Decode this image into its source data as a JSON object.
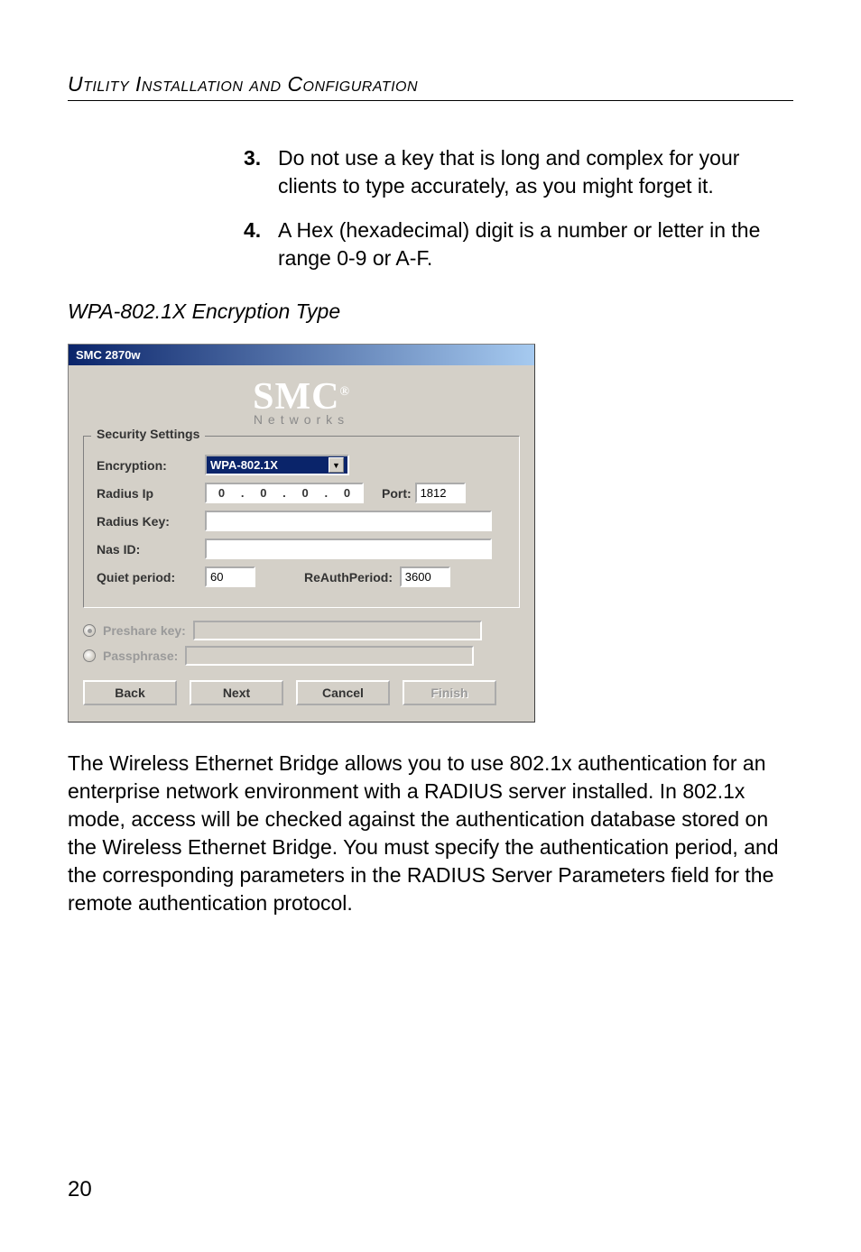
{
  "header": "Utility Installation and Configuration",
  "list": {
    "item3_num": "3.",
    "item3_text": "Do not use a key that is long and complex for your clients to type accurately, as you might forget it.",
    "item4_num": "4.",
    "item4_text": "A Hex (hexadecimal) digit is a number or letter in the range 0-9 or A-F."
  },
  "subheading": "WPA-802.1X Encryption Type",
  "dialog": {
    "title": "SMC 2870w",
    "logo": "SMC",
    "logo_r": "®",
    "logo_sub": "Networks",
    "group_legend": "Security Settings",
    "encryption_label": "Encryption:",
    "encryption_value": "WPA-802.1X",
    "radiusip_label": "Radius Ip",
    "ip_oct1": "0",
    "ip_oct2": "0",
    "ip_oct3": "0",
    "ip_oct4": "0",
    "port_label": "Port:",
    "port_value": "1812",
    "radiuskey_label": "Radius Key:",
    "radiuskey_value": "",
    "nasid_label": "Nas ID:",
    "nasid_value": "",
    "quiet_label": "Quiet period:",
    "quiet_value": "60",
    "reauth_label": "ReAuthPeriod:",
    "reauth_value": "3600",
    "preshare_label": "Preshare key:",
    "passphrase_label": "Passphrase:",
    "back": "Back",
    "next": "Next",
    "cancel": "Cancel",
    "finish": "Finish"
  },
  "body_para": "The Wireless Ethernet Bridge allows you to use 802.1x authentication for an enterprise network environment with a RADIUS server installed. In 802.1x mode, access will be checked against the authentication database stored on the Wireless Ethernet Bridge. You must specify the authentication period, and the corresponding parameters in the RADIUS Server Parameters field for the remote authentication protocol.",
  "page_number": "20"
}
